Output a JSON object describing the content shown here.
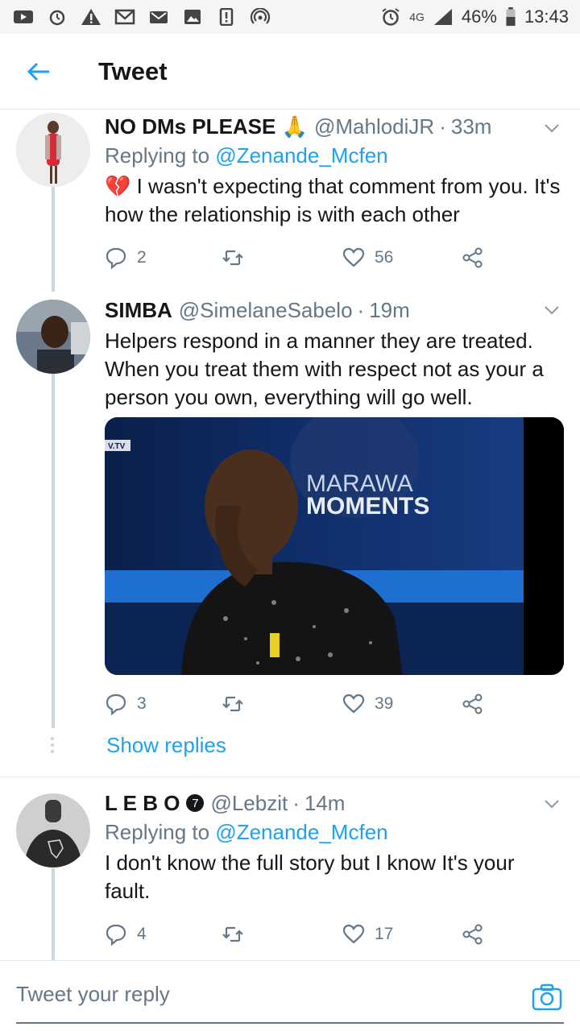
{
  "status_bar": {
    "battery": "46%",
    "time": "13:43",
    "network": "4G"
  },
  "header": {
    "title": "Tweet"
  },
  "tweets": [
    {
      "name": "NO DMs PLEASE 🙏",
      "handle": "@MahlodiJR",
      "time": "33m",
      "replying_prefix": "Replying to ",
      "replying_to": "@Zenande_Mcfen",
      "text": "💔 I wasn't expecting that comment from you. It's how the relationship is with each other",
      "replies": "2",
      "retweets": "",
      "likes": "56"
    },
    {
      "name": "SIMBA",
      "handle": "@SimelaneSabelo",
      "time": "19m",
      "text": "Helpers respond in a manner they are treated. When you treat them with respect not as your a person you own, everything will go well.",
      "media_caption_line1": "MARAWA",
      "media_caption_line2": "MOMENTS",
      "media_logo": "V.TV",
      "replies": "3",
      "retweets": "",
      "likes": "39",
      "show_replies": "Show replies"
    },
    {
      "name": "L E B O",
      "handle": "@Lebzit",
      "time": "14m",
      "replying_prefix": "Replying to ",
      "replying_to": "@Zenande_Mcfen",
      "text": "I don't know the full story but I know It's your fault.",
      "replies": "4",
      "retweets": "",
      "likes": "17"
    }
  ],
  "reply_bar": {
    "placeholder": "Tweet your reply"
  },
  "colors": {
    "accent": "#1da1f2",
    "secondary_text": "#657786",
    "divider": "#e1e8ed"
  }
}
